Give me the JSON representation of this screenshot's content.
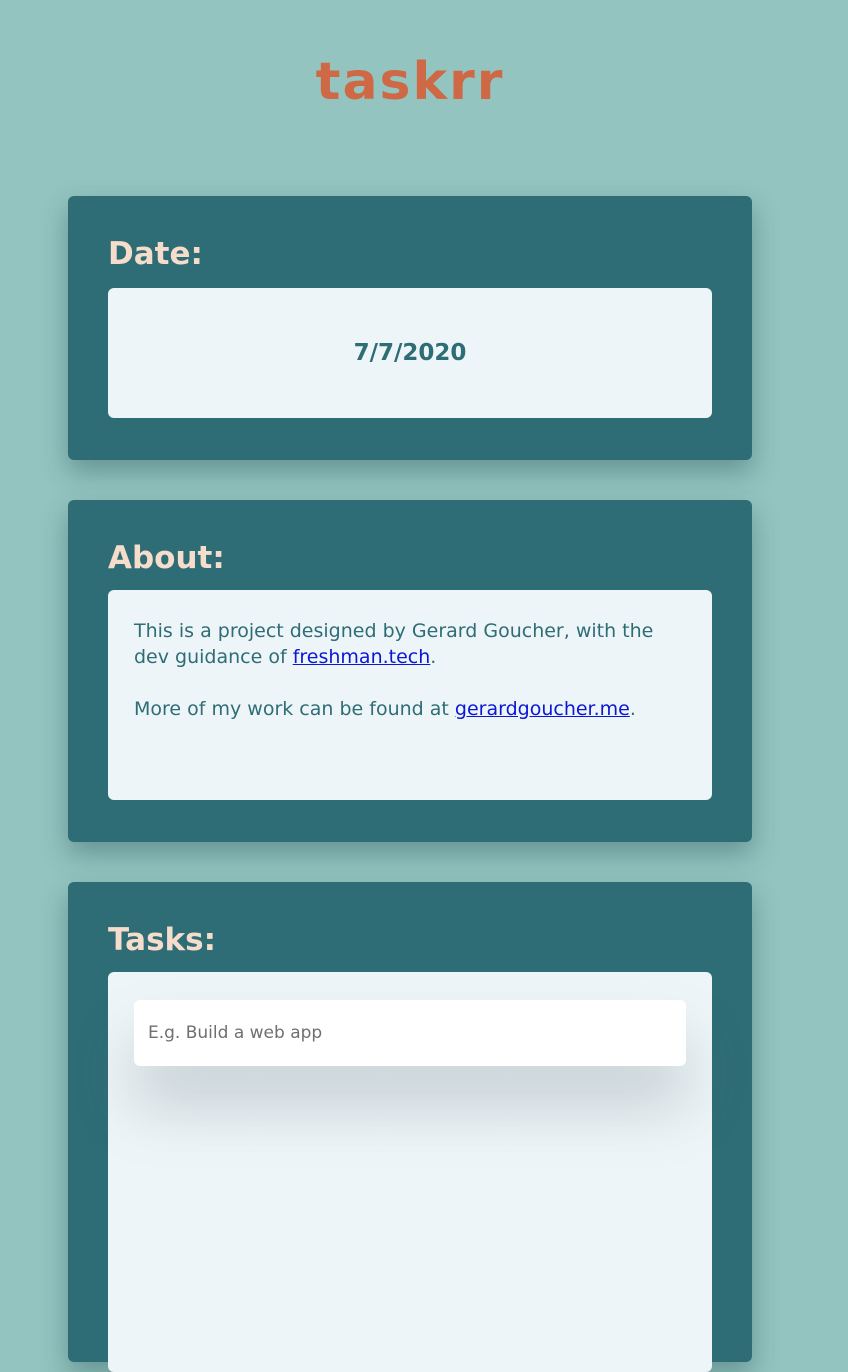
{
  "app": {
    "logo": "taskrr"
  },
  "date_card": {
    "title": "Date:",
    "value": "7/7/2020"
  },
  "about_card": {
    "title": "About:",
    "line1_prefix": "This is a project designed by Gerard Goucher, with the dev guidance of ",
    "line1_link": "freshman.tech",
    "line1_suffix": ".",
    "line2_prefix": "More of my work can be found at ",
    "line2_link": "gerardgoucher.me",
    "line2_suffix": "."
  },
  "tasks_card": {
    "title": "Tasks:",
    "input_placeholder": "E.g. Build a web app",
    "input_value": ""
  },
  "colors": {
    "page_background": "#93c4c0",
    "card_background": "#2e6d76",
    "card_title": "#f6dccb",
    "panel_background": "#edf5f8",
    "logo": "#cf6844",
    "link": "#0b17d6"
  }
}
